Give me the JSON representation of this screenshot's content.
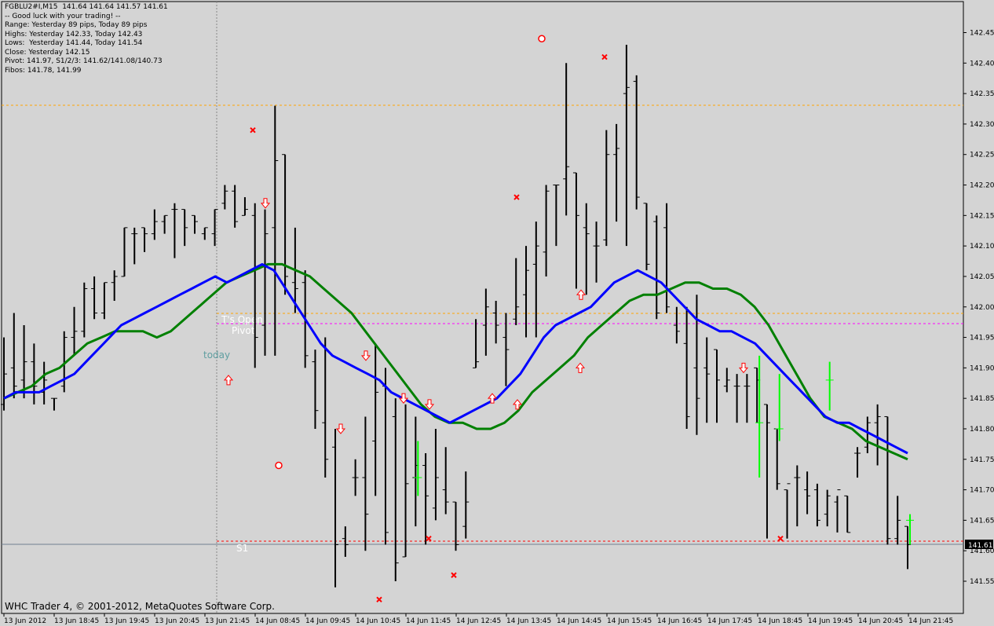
{
  "info": {
    "symbol_line": "FGBLU2#I,M15  141.64 141.64 141.57 141.61",
    "lines": [
      "-- Good luck with your trading! --",
      "Range: Yesterday 89 pips, Today 89 pips",
      "Highs: Yesterday 142.33, Today 142.43",
      "Lows:  Yesterday 141.44, Today 141.54",
      "Close: Yesterday 142.15",
      "Pivot: 141.97, S1/2/3: 141.62/141.08/140.73",
      "Fibos: 141.78, 141.99"
    ]
  },
  "copyright": "WHC Trader 4, © 2001-2012, MetaQuotes Software Corp.",
  "price_tag": "141.61",
  "labels": {
    "ts_open": "T's Open",
    "pivot": "Pivot",
    "today": "today",
    "s1": "S1"
  },
  "colors": {
    "background": "#d4d4d4",
    "bars": "#000000",
    "bull_bars": "#00ff00",
    "ma_fast": "#0000ff",
    "ma_slow": "#008000",
    "arrows": "#ff0000",
    "high_level": "#ffa500",
    "pivot_level": "#ff00ff",
    "s1_level": "#ff0000"
  },
  "chart_data": {
    "type": "ohlc",
    "title": "FGBLU2#I,M15",
    "y_ticks": [
      "142.45",
      "142.40",
      "142.35",
      "142.30",
      "142.25",
      "142.20",
      "142.15",
      "142.10",
      "142.05",
      "142.00",
      "141.95",
      "141.90",
      "141.85",
      "141.80",
      "141.75",
      "141.70",
      "141.65",
      "141.60",
      "141.55"
    ],
    "x_ticks": [
      "13 Jun 2012",
      "13 Jun 18:45",
      "13 Jun 19:45",
      "13 Jun 20:45",
      "13 Jun 21:45",
      "14 Jun 08:45",
      "14 Jun 09:45",
      "14 Jun 10:45",
      "14 Jun 11:45",
      "14 Jun 12:45",
      "14 Jun 13:45",
      "14 Jun 14:45",
      "14 Jun 15:45",
      "14 Jun 16:45",
      "14 Jun 17:45",
      "14 Jun 18:45",
      "14 Jun 19:45",
      "14 Jun 20:45",
      "14 Jun 21:45"
    ],
    "ylim": [
      141.52,
      142.49
    ],
    "levels": {
      "yesterday_high": 142.33,
      "todays_open": 141.99,
      "pivot": 141.97,
      "s1": 141.62,
      "current": 141.61
    },
    "bars": [
      [
        141.84,
        141.95,
        141.83,
        141.89
      ],
      [
        141.9,
        141.99,
        141.85,
        141.87
      ],
      [
        141.88,
        141.97,
        141.85,
        141.91
      ],
      [
        141.91,
        141.94,
        141.84,
        141.87
      ],
      [
        141.86,
        141.91,
        141.84,
        141.88
      ],
      [
        141.85,
        141.85,
        141.83,
        141.85
      ],
      [
        141.87,
        141.96,
        141.86,
        141.95
      ],
      [
        141.95,
        142.0,
        141.92,
        141.96
      ],
      [
        141.96,
        142.04,
        141.95,
        142.03
      ],
      [
        142.03,
        142.05,
        141.98,
        141.99
      ],
      [
        141.99,
        142.04,
        141.98,
        142.04
      ],
      [
        142.04,
        142.06,
        142.01,
        142.05
      ],
      [
        142.05,
        142.13,
        142.05,
        142.13
      ],
      [
        142.12,
        142.13,
        142.07,
        142.12
      ],
      [
        142.13,
        142.13,
        142.09,
        142.12
      ],
      [
        142.12,
        142.16,
        142.11,
        142.14
      ],
      [
        142.14,
        142.15,
        142.12,
        142.15
      ],
      [
        142.16,
        142.17,
        142.08,
        142.16
      ],
      [
        142.16,
        142.16,
        142.1,
        142.13
      ],
      [
        142.15,
        142.15,
        142.12,
        142.14
      ],
      [
        142.12,
        142.13,
        142.11,
        142.13
      ],
      [
        142.12,
        142.16,
        142.1,
        142.16
      ],
      [
        142.17,
        142.2,
        142.16,
        142.19
      ],
      [
        142.19,
        142.2,
        142.13,
        142.14
      ],
      [
        142.15,
        142.18,
        142.15,
        142.16
      ],
      [
        142.15,
        142.17,
        141.9,
        141.95
      ],
      [
        141.97,
        142.16,
        141.92,
        142.12
      ],
      [
        142.13,
        142.33,
        141.92,
        142.24
      ],
      [
        142.25,
        142.25,
        142.02,
        142.05
      ],
      [
        142.04,
        142.13,
        141.99,
        142.03
      ],
      [
        142.04,
        142.06,
        141.9,
        141.92
      ],
      [
        141.91,
        141.93,
        141.8,
        141.83
      ],
      [
        141.81,
        141.95,
        141.72,
        141.75
      ],
      [
        141.77,
        141.8,
        141.54,
        141.61
      ],
      [
        141.62,
        141.64,
        141.59,
        141.61
      ],
      [
        141.72,
        141.75,
        141.69,
        141.72
      ],
      [
        141.72,
        141.82,
        141.6,
        141.66
      ],
      [
        141.78,
        141.94,
        141.69,
        141.86
      ],
      [
        141.87,
        141.9,
        141.61,
        141.63
      ],
      [
        141.82,
        141.85,
        141.55,
        141.58
      ],
      [
        141.59,
        141.84,
        141.59,
        141.71
      ],
      [
        141.72,
        141.82,
        141.64,
        141.74
      ],
      [
        141.74,
        141.76,
        141.61,
        141.69
      ],
      [
        141.67,
        141.8,
        141.65,
        141.72
      ],
      [
        141.7,
        141.77,
        141.66,
        141.68
      ],
      [
        141.68,
        141.68,
        141.6,
        141.61
      ],
      [
        141.64,
        141.73,
        141.62,
        141.68
      ],
      [
        141.9,
        141.98,
        141.9,
        141.91
      ],
      [
        141.97,
        142.03,
        141.92,
        142.0
      ],
      [
        141.99,
        142.01,
        141.94,
        141.97
      ],
      [
        141.95,
        141.99,
        141.87,
        141.93
      ],
      [
        141.98,
        142.08,
        141.97,
        142.0
      ],
      [
        142.02,
        142.1,
        141.95,
        142.06
      ],
      [
        142.07,
        142.14,
        141.95,
        142.1
      ],
      [
        142.09,
        142.2,
        142.05,
        142.19
      ],
      [
        142.2,
        142.2,
        142.1,
        142.2
      ],
      [
        142.21,
        142.4,
        142.15,
        142.23
      ],
      [
        142.22,
        142.22,
        142.03,
        142.15
      ],
      [
        142.13,
        142.17,
        142.02,
        142.12
      ],
      [
        142.1,
        142.14,
        142.04,
        142.1
      ],
      [
        142.11,
        142.29,
        142.1,
        142.25
      ],
      [
        142.25,
        142.3,
        142.14,
        142.26
      ],
      [
        142.35,
        142.43,
        142.1,
        142.36
      ],
      [
        142.37,
        142.38,
        142.16,
        142.18
      ],
      [
        142.17,
        142.17,
        142.06,
        142.07
      ],
      [
        142.14,
        142.15,
        141.98,
        141.99
      ],
      [
        142.13,
        142.17,
        141.99,
        142.0
      ],
      [
        141.97,
        142.0,
        141.94,
        141.96
      ],
      [
        141.94,
        142.0,
        141.8,
        141.82
      ],
      [
        141.9,
        142.02,
        141.79,
        141.85
      ],
      [
        141.9,
        141.95,
        141.81,
        141.89
      ],
      [
        141.93,
        141.93,
        141.81,
        141.88
      ],
      [
        141.87,
        141.9,
        141.86,
        141.88
      ],
      [
        141.87,
        141.89,
        141.81,
        141.87
      ],
      [
        141.87,
        141.89,
        141.81,
        141.87
      ],
      [
        141.9,
        141.9,
        141.81,
        141.88
      ],
      [
        141.84,
        141.84,
        141.62,
        141.81
      ],
      [
        141.8,
        141.8,
        141.7,
        141.71
      ],
      [
        141.7,
        141.7,
        141.62,
        141.71
      ],
      [
        141.72,
        141.74,
        141.64,
        141.72
      ],
      [
        141.7,
        141.73,
        141.66,
        141.69
      ],
      [
        141.7,
        141.71,
        141.64,
        141.65
      ],
      [
        141.66,
        141.7,
        141.64,
        141.69
      ],
      [
        141.68,
        141.69,
        141.63,
        141.7
      ],
      [
        141.69,
        141.69,
        141.63,
        141.63
      ],
      [
        141.76,
        141.77,
        141.72,
        141.76
      ],
      [
        141.77,
        141.82,
        141.76,
        141.81
      ],
      [
        141.81,
        141.84,
        141.74,
        141.82
      ],
      [
        141.82,
        141.82,
        141.61,
        141.62
      ],
      [
        141.62,
        141.69,
        141.61,
        141.65
      ],
      [
        141.64,
        141.64,
        141.57,
        141.61
      ]
    ],
    "bullish_bars": [
      [
        141.72,
        141.78,
        141.69,
        141.72
      ],
      [
        141.81,
        141.92,
        141.72,
        141.81
      ],
      [
        141.8,
        141.89,
        141.78,
        141.8
      ],
      [
        141.88,
        141.91,
        141.83,
        141.88
      ],
      [
        141.65,
        141.66,
        141.61,
        141.65
      ]
    ],
    "ma_fast": [
      141.85,
      141.86,
      141.86,
      141.86,
      141.87,
      141.88,
      141.89,
      141.91,
      141.93,
      141.95,
      141.97,
      141.98,
      141.99,
      142.0,
      142.01,
      142.02,
      142.03,
      142.04,
      142.05,
      142.04,
      142.05,
      142.06,
      142.07,
      142.06,
      142.03,
      142.0,
      141.97,
      141.94,
      141.92,
      141.91,
      141.9,
      141.89,
      141.88,
      141.86,
      141.85,
      141.84,
      141.83,
      141.82,
      141.81,
      141.82,
      141.83,
      141.84,
      141.85,
      141.87,
      141.89,
      141.92,
      141.95,
      141.97,
      141.98,
      141.99,
      142.0,
      142.02,
      142.04,
      142.05,
      142.06,
      142.05,
      142.04,
      142.02,
      142.0,
      141.98,
      141.97,
      141.96,
      141.96,
      141.95,
      141.94,
      141.92,
      141.9,
      141.88,
      141.86,
      141.84,
      141.82,
      141.81,
      141.81,
      141.8,
      141.79,
      141.78,
      141.77,
      141.76
    ],
    "ma_slow": [
      141.85,
      141.86,
      141.87,
      141.89,
      141.9,
      141.92,
      141.94,
      141.95,
      141.96,
      141.96,
      141.96,
      141.95,
      141.96,
      141.98,
      142.0,
      142.02,
      142.04,
      142.05,
      142.06,
      142.07,
      142.07,
      142.06,
      142.05,
      142.03,
      142.01,
      141.99,
      141.96,
      141.93,
      141.9,
      141.87,
      141.84,
      141.82,
      141.81,
      141.81,
      141.8,
      141.8,
      141.81,
      141.83,
      141.86,
      141.88,
      141.9,
      141.92,
      141.95,
      141.97,
      141.99,
      142.01,
      142.02,
      142.02,
      142.03,
      142.04,
      142.04,
      142.03,
      142.03,
      142.02,
      142.0,
      141.97,
      141.93,
      141.89,
      141.85,
      141.82,
      141.81,
      141.8,
      141.78,
      141.77,
      141.76,
      141.75
    ],
    "arrows_up": [
      141.88,
      141.85,
      141.84,
      141.9,
      142.02
    ],
    "arrows_down": [
      142.17,
      141.92,
      141.8,
      141.85,
      141.84,
      141.9
    ],
    "crosses": [
      142.29,
      142.18,
      142.41,
      141.62,
      141.56,
      141.52,
      141.62
    ],
    "fractal_marks": [
      141.74,
      142.44
    ]
  }
}
